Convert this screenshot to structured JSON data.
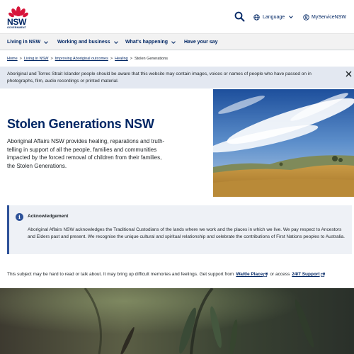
{
  "header": {
    "logo": {
      "wordmark": "NSW",
      "subtext": "GOVERNMENT",
      "icon": "waratah-logo-icon"
    },
    "search_icon": "search-icon",
    "language_label": "Language",
    "account_label": "MyServiceNSW"
  },
  "nav": {
    "items": [
      {
        "label": "Living in NSW",
        "has_dropdown": true
      },
      {
        "label": "Working and business",
        "has_dropdown": true
      },
      {
        "label": "What's happening",
        "has_dropdown": true
      },
      {
        "label": "Have your say",
        "has_dropdown": false
      }
    ]
  },
  "breadcrumb": {
    "items": [
      "Home",
      "Living in NSW",
      "Improving Aboriginal outcomes",
      "Healing"
    ],
    "current": "Stolen Generations"
  },
  "notice": {
    "text": "Aboriginal and Torres Strait Islander people should be aware that this website may contain images, voices or names of people who have passed on in photographs, film, audio recordings or printed material."
  },
  "hero": {
    "title": "Stolen Generations NSW",
    "description": "Aboriginal Affairs NSW provides healing, reparations and truth-telling in support of all the people, families and communities impacted by the forced removal of children from their families, the Stolen Generations."
  },
  "acknowledgement": {
    "title": "Acknowledgement",
    "text": "Aboriginal Affairs NSW acknowledges the Traditional Custodians of the lands where we work and the places in which we live. We pay respect to Ancestors and Elders past and present. We recognise the unique cultural and spiritual relationship and celebrate the contributions of First Nations peoples to Australia."
  },
  "support": {
    "prefix": "This subject may be hard to read or talk about. It may bring up difficult memories and feelings. Get support from",
    "link1": "Wattle Place",
    "middle": "or access",
    "link2": "24/7 Support"
  },
  "colors": {
    "brand_navy": "#002664",
    "brand_red": "#d7153a",
    "nav_bg": "#f2f2f2",
    "notice_bg": "#e3e8f1",
    "info_accent": "#2e5299"
  }
}
